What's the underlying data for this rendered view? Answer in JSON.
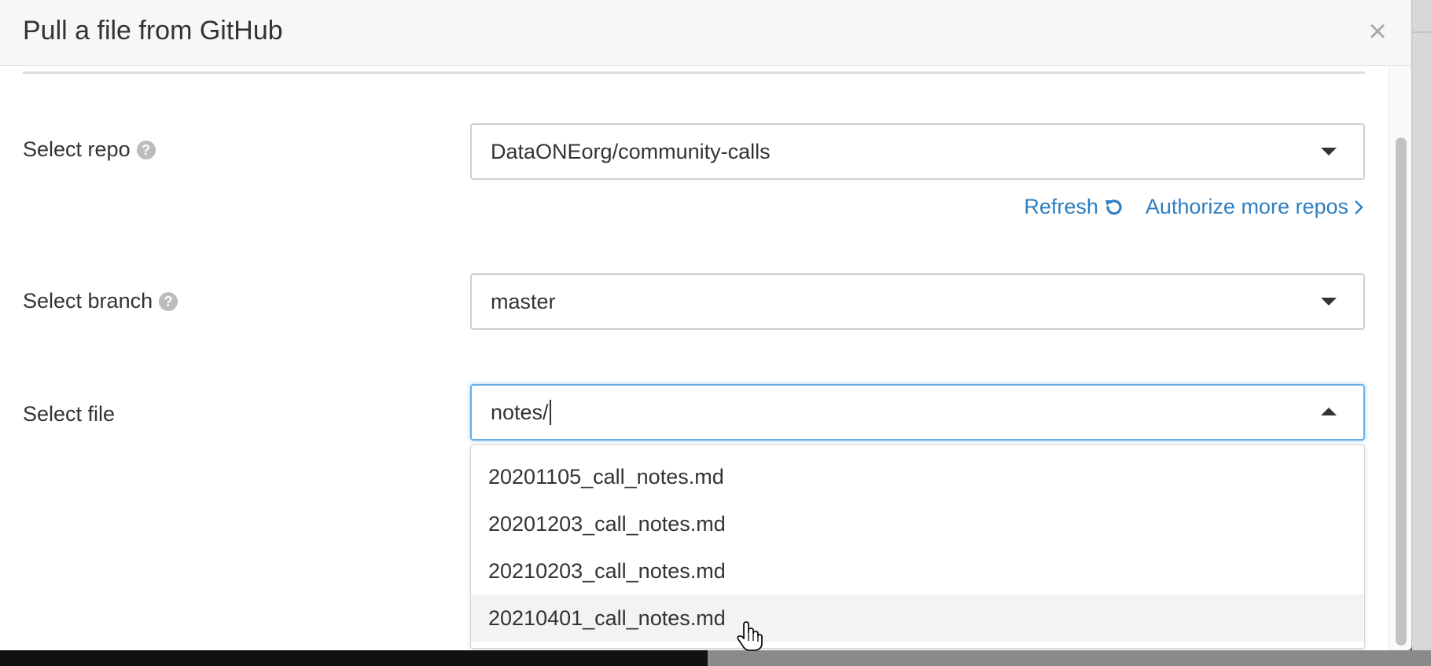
{
  "modal": {
    "title": "Pull a file from GitHub",
    "close_label": "×"
  },
  "repo": {
    "label": "Select repo",
    "value": "DataONEorg/community-calls"
  },
  "links": {
    "refresh": "Refresh",
    "authorize": "Authorize more repos"
  },
  "branch": {
    "label": "Select branch",
    "value": "master"
  },
  "file": {
    "label": "Select file",
    "value": "notes/",
    "options": [
      "20201105_call_notes.md",
      "20201203_call_notes.md",
      "20210203_call_notes.md",
      "20210401_call_notes.md"
    ],
    "hovered_index": 3
  },
  "icons": {
    "help": "question-circle-icon",
    "refresh": "refresh-icon",
    "chevron": "chevron-right-icon",
    "caret": "caret-icon"
  },
  "colors": {
    "link": "#2f7fc1",
    "focus": "#66afe9"
  }
}
